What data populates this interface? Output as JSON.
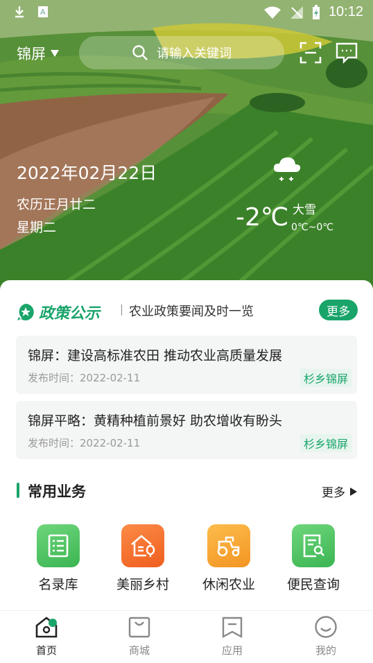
{
  "status_bar": {
    "time": "10:12"
  },
  "header": {
    "city": "锦屏",
    "search_placeholder": "请输入关键词"
  },
  "date_info": {
    "date": "2022年02月22日",
    "lunar": "农历正月廿二",
    "weekday": "星期二"
  },
  "weather": {
    "temperature": "-2℃",
    "description": "大雪",
    "range": "0℃~0℃",
    "icon": "snow-cloud-icon"
  },
  "policy": {
    "title": "政策公示",
    "subtitle": "农业政策要闻及时一览",
    "more_label": "更多",
    "items": [
      {
        "title": "锦屏：建设高标准农田 推动农业高质量发展",
        "time": "发布时间：2022-02-11",
        "tag": "杉乡锦屏"
      },
      {
        "title": "锦屏平略：黄精种植前景好 助农增收有盼头",
        "time": "发布时间：2022-02-11",
        "tag": "杉乡锦屏"
      }
    ]
  },
  "services": {
    "title": "常用业务",
    "more_label": "更多",
    "items": [
      {
        "label": "名录库",
        "icon": "list-document-icon",
        "color": "#4cc35f"
      },
      {
        "label": "美丽乡村",
        "icon": "house-tree-icon",
        "color": "#f2722c"
      },
      {
        "label": "休闲农业",
        "icon": "tractor-icon",
        "color": "#f6a32e"
      },
      {
        "label": "便民查询",
        "icon": "document-search-icon",
        "color": "#4cc35f"
      }
    ]
  },
  "tabbar": {
    "items": [
      {
        "label": "首页",
        "icon": "home-icon",
        "active": true
      },
      {
        "label": "商城",
        "icon": "shopping-bag-icon"
      },
      {
        "label": "应用",
        "icon": "bookmark-icon"
      },
      {
        "label": "我的",
        "icon": "smile-face-icon"
      }
    ]
  },
  "colors": {
    "accent": "#19a46a"
  }
}
